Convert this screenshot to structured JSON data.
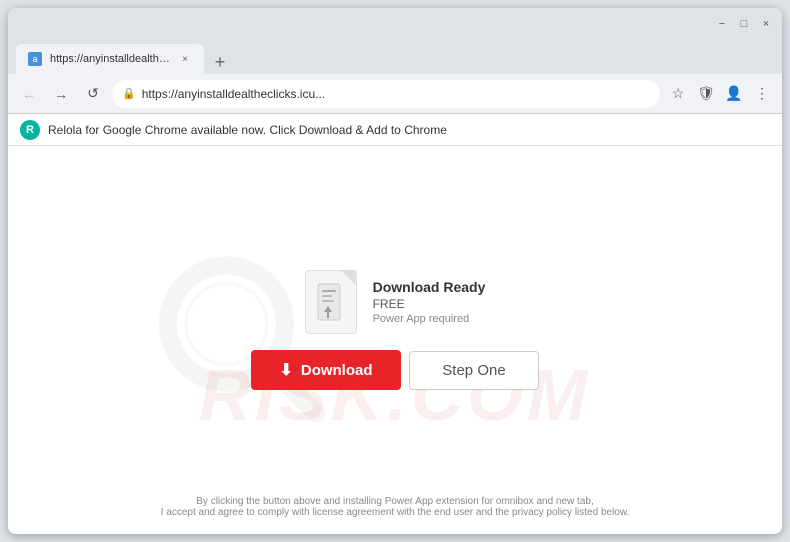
{
  "browser": {
    "title_bar": {
      "minimize_label": "−",
      "maximize_label": "□",
      "close_label": "×"
    },
    "tab": {
      "favicon_letter": "a",
      "label": "https://anyinstalldealtheclicks.icu...",
      "close_label": "×"
    },
    "new_tab_label": "+",
    "address_bar": {
      "back_label": "←",
      "forward_label": "→",
      "refresh_label": "↺",
      "url": "https://anyinstalldealtheclicks.icu...",
      "lock_icon": "🔒",
      "bookmark_label": "☆",
      "shield_label": "🛡",
      "avatar_label": "👤",
      "menu_label": "⋮"
    },
    "notification": {
      "logo_letter": "R",
      "text": "Relola for Google Chrome  available now. Click Download & Add to Chrome"
    }
  },
  "page": {
    "download_card": {
      "app_icon_symbol": "🔧",
      "title": "Download Ready",
      "price": "FREE",
      "requirement": "Power App required",
      "download_button": "Download",
      "step_button": "Step One"
    },
    "footer_line1": "By clicking the button above and installing  Power App  extension for omnibox and new tab,",
    "footer_line2": "I accept and agree to comply with license agreement with the end user and the privacy policy listed below.",
    "watermark_text": "RISK.COM"
  }
}
